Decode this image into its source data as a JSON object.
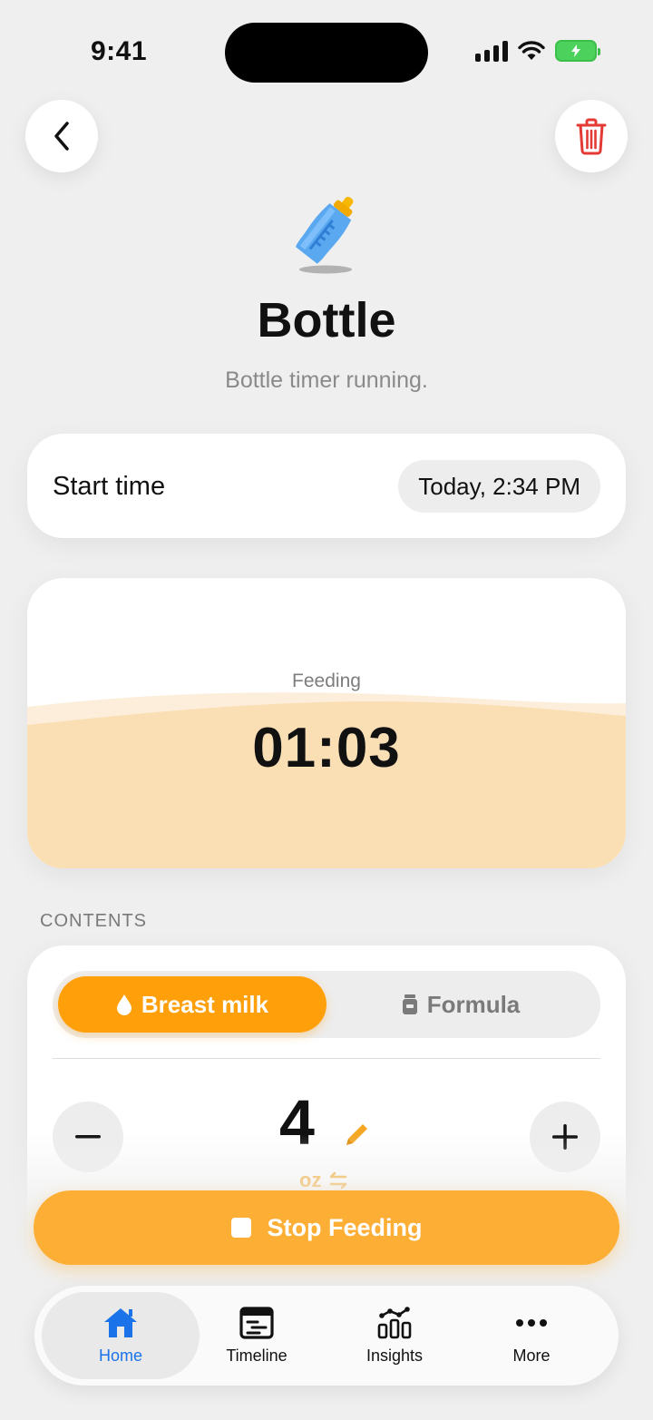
{
  "status_bar": {
    "time": "9:41"
  },
  "header": {
    "title": "Bottle",
    "subtitle": "Bottle timer running."
  },
  "start_time": {
    "label": "Start time",
    "value": "Today, 2:34 PM"
  },
  "timer": {
    "label": "Feeding",
    "value": "01:03"
  },
  "contents": {
    "section_label": "CONTENTS",
    "options": [
      {
        "label": "Breast milk",
        "icon": "droplet-icon",
        "selected": true
      },
      {
        "label": "Formula",
        "icon": "formula-can-icon",
        "selected": false
      }
    ],
    "amount": "4",
    "unit": "oz"
  },
  "action": {
    "stop_label": "Stop Feeding"
  },
  "tabs": [
    {
      "label": "Home",
      "icon": "house-icon",
      "active": true
    },
    {
      "label": "Timeline",
      "icon": "timeline-icon",
      "active": false
    },
    {
      "label": "Insights",
      "icon": "insights-icon",
      "active": false
    },
    {
      "label": "More",
      "icon": "ellipsis-icon",
      "active": false
    }
  ],
  "colors": {
    "accent": "#ff9f0a",
    "tab_active": "#1a73e8",
    "delete": "#e53935",
    "battery": "#4cd15c"
  }
}
